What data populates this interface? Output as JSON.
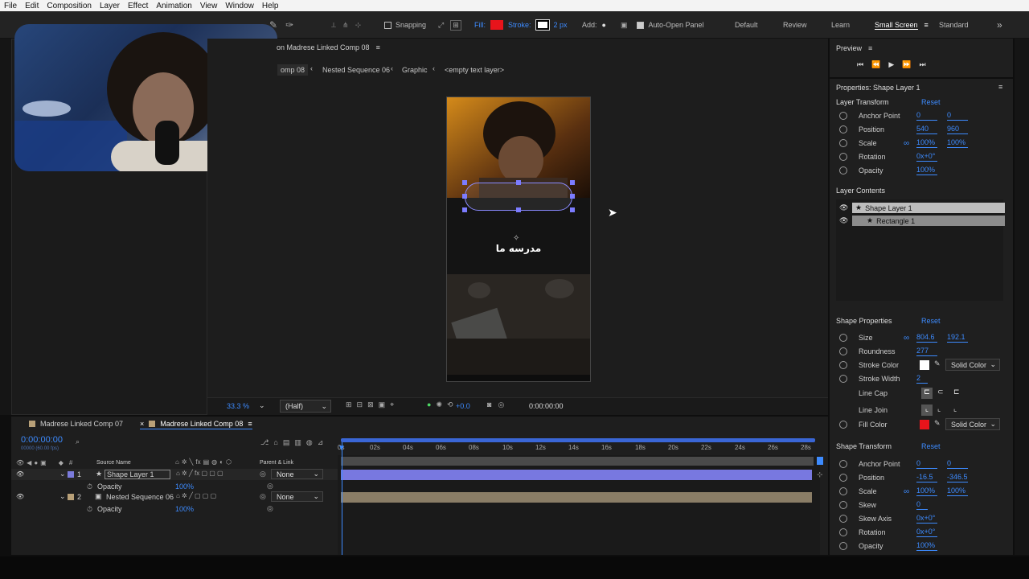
{
  "menu": [
    "File",
    "Edit",
    "Composition",
    "Layer",
    "Effect",
    "Animation",
    "View",
    "Window",
    "Help"
  ],
  "toolbar": {
    "snapping": "Snapping",
    "fill": "Fill:",
    "stroke": "Stroke:",
    "stroke_width": "2 px",
    "add": "Add:",
    "auto_open": "Auto-Open Panel",
    "fill_color": "#e8141b",
    "workspaces": [
      "Default",
      "Review",
      "Learn",
      "Small Screen",
      "Standard"
    ],
    "active_workspace": "Small Screen"
  },
  "composition": {
    "title": "on Madrese Linked Comp 08",
    "breadcrumbs": [
      "omp 08",
      "Nested Sequence 06",
      "Graphic",
      "<empty text layer>"
    ],
    "overlay_text": "مدرسه ما",
    "zoom": "33.3 %",
    "resolution": "(Half)",
    "exposure": "+0.0",
    "timecode": "0:00:00:00"
  },
  "preview": {
    "title": "Preview"
  },
  "properties": {
    "title": "Properties: Shape Layer 1",
    "layer_transform": {
      "title": "Layer Transform",
      "reset": "Reset",
      "rows": [
        {
          "label": "Anchor Point",
          "v1": "0",
          "v2": "0"
        },
        {
          "label": "Position",
          "v1": "540",
          "v2": "960"
        },
        {
          "label": "Scale",
          "v1": "100%",
          "v2": "100%"
        },
        {
          "label": "Rotation",
          "v1": "0x+0°",
          "v2": ""
        },
        {
          "label": "Opacity",
          "v1": "100%",
          "v2": ""
        }
      ]
    },
    "layer_contents": {
      "title": "Layer Contents",
      "items": [
        "Shape Layer 1",
        "Rectangle 1"
      ]
    },
    "shape_properties": {
      "title": "Shape Properties",
      "reset": "Reset",
      "size_w": "804.6",
      "size_h": "192.1",
      "roundness": "277",
      "stroke_width": "2",
      "labels": {
        "size": "Size",
        "roundness": "Roundness",
        "stroke_color": "Stroke Color",
        "stroke_width": "Stroke Width",
        "line_cap": "Line Cap",
        "line_join": "Line Join",
        "fill_color": "Fill Color"
      },
      "stroke_type": "Solid Color",
      "fill_type": "Solid Color",
      "stroke_swatch": "#ffffff",
      "fill_swatch": "#e8141b"
    },
    "shape_transform": {
      "title": "Shape Transform",
      "reset": "Reset",
      "rows": [
        {
          "label": "Anchor Point",
          "v1": "0",
          "v2": "0"
        },
        {
          "label": "Position",
          "v1": "-16.5",
          "v2": "-346.5"
        },
        {
          "label": "Scale",
          "v1": "100%",
          "v2": "100%"
        },
        {
          "label": "Skew",
          "v1": "0",
          "v2": ""
        },
        {
          "label": "Skew Axis",
          "v1": "0x+0°",
          "v2": ""
        },
        {
          "label": "Rotation",
          "v1": "0x+0°",
          "v2": ""
        },
        {
          "label": "Opacity",
          "v1": "100%",
          "v2": ""
        }
      ]
    }
  },
  "timeline": {
    "tabs": [
      "Madrese Linked Comp 07",
      "Madrese Linked Comp 08"
    ],
    "timecode": "0:00:00:00",
    "fps_note": "00000 (60.00 fps)",
    "col_source": "Source Name",
    "col_parent": "Parent & Link",
    "ruler": [
      "0s",
      "02s",
      "04s",
      "06s",
      "08s",
      "10s",
      "12s",
      "14s",
      "16s",
      "18s",
      "20s",
      "22s",
      "24s",
      "26s",
      "28s"
    ],
    "layers": [
      {
        "num": "1",
        "name": "Shape Layer 1",
        "parent": "None",
        "prop": "Opacity",
        "value": "100%",
        "label_color": "#7b7bdc"
      },
      {
        "num": "2",
        "name": "Nested Sequence 06",
        "parent": "None",
        "prop": "Opacity",
        "value": "100%",
        "label_color": "#b8a078"
      }
    ]
  }
}
